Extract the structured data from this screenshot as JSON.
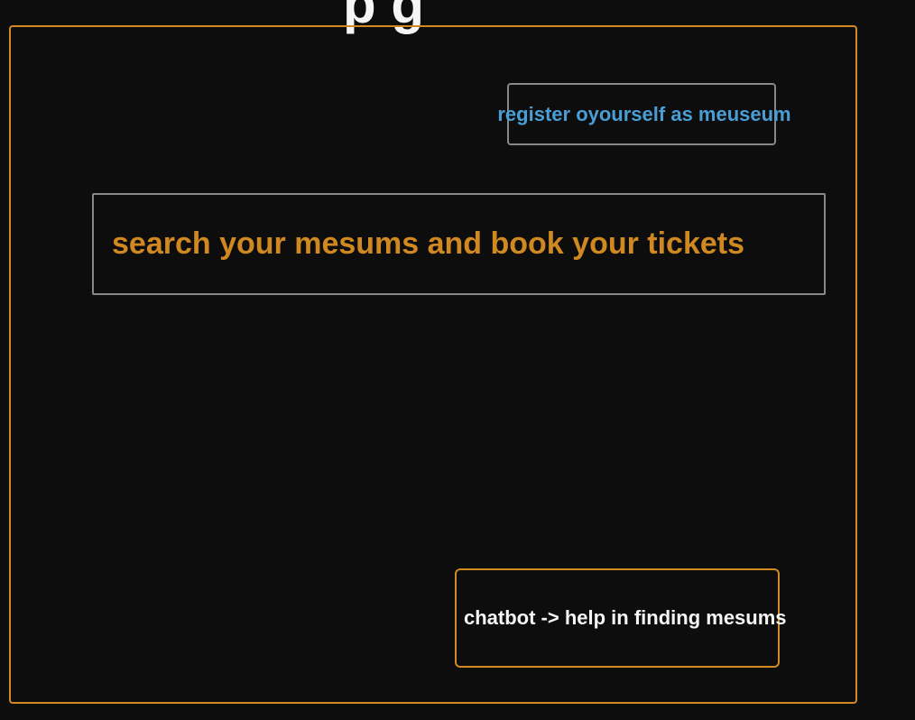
{
  "title_partial": "p g",
  "register": {
    "label": "register oyourself as meuseum"
  },
  "search": {
    "placeholder": "search your mesums and book your tickets"
  },
  "chatbot": {
    "label": "chatbot -> help in finding mesums"
  },
  "colors": {
    "accent": "#d08820",
    "link": "#4a9ed6",
    "text": "#f5f5f5",
    "background": "#0d0d0d"
  }
}
